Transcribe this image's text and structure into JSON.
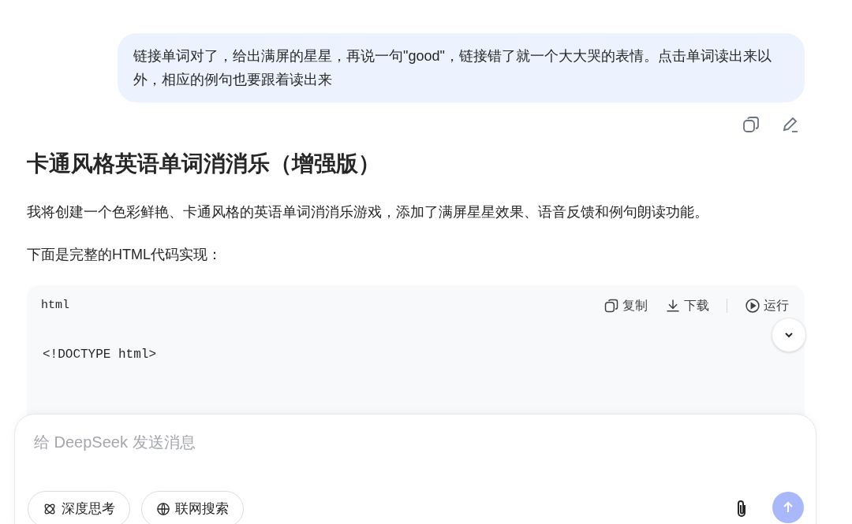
{
  "user_message": {
    "text": "链接单词对了，给出满屏的星星，再说一句\"good\"，链接错了就一个大大哭的表情。点击单词读出来以外，相应的例句也要跟着读出来"
  },
  "reply": {
    "heading": "卡通风格英语单词消消乐（增强版）",
    "paragraphs": [
      "我将创建一个色彩鲜艳、卡通风格的英语单词消消乐游戏，添加了满屏星星效果、语音反馈和例句朗读功能。",
      "下面是完整的HTML代码实现："
    ],
    "code_block": {
      "language": "html",
      "actions": [
        {
          "kind": "copy",
          "label": "复制"
        },
        {
          "kind": "download",
          "label": "下载"
        },
        {
          "kind": "run",
          "label": "运行"
        }
      ],
      "lines": [
        "<!DOCTYPE html>"
      ]
    }
  },
  "composer": {
    "placeholder": "给 DeepSeek 发送消息",
    "toggles": [
      {
        "kind": "think",
        "label": "深度思考",
        "on": false
      },
      {
        "kind": "search",
        "label": "联网搜索",
        "on": false
      }
    ]
  }
}
